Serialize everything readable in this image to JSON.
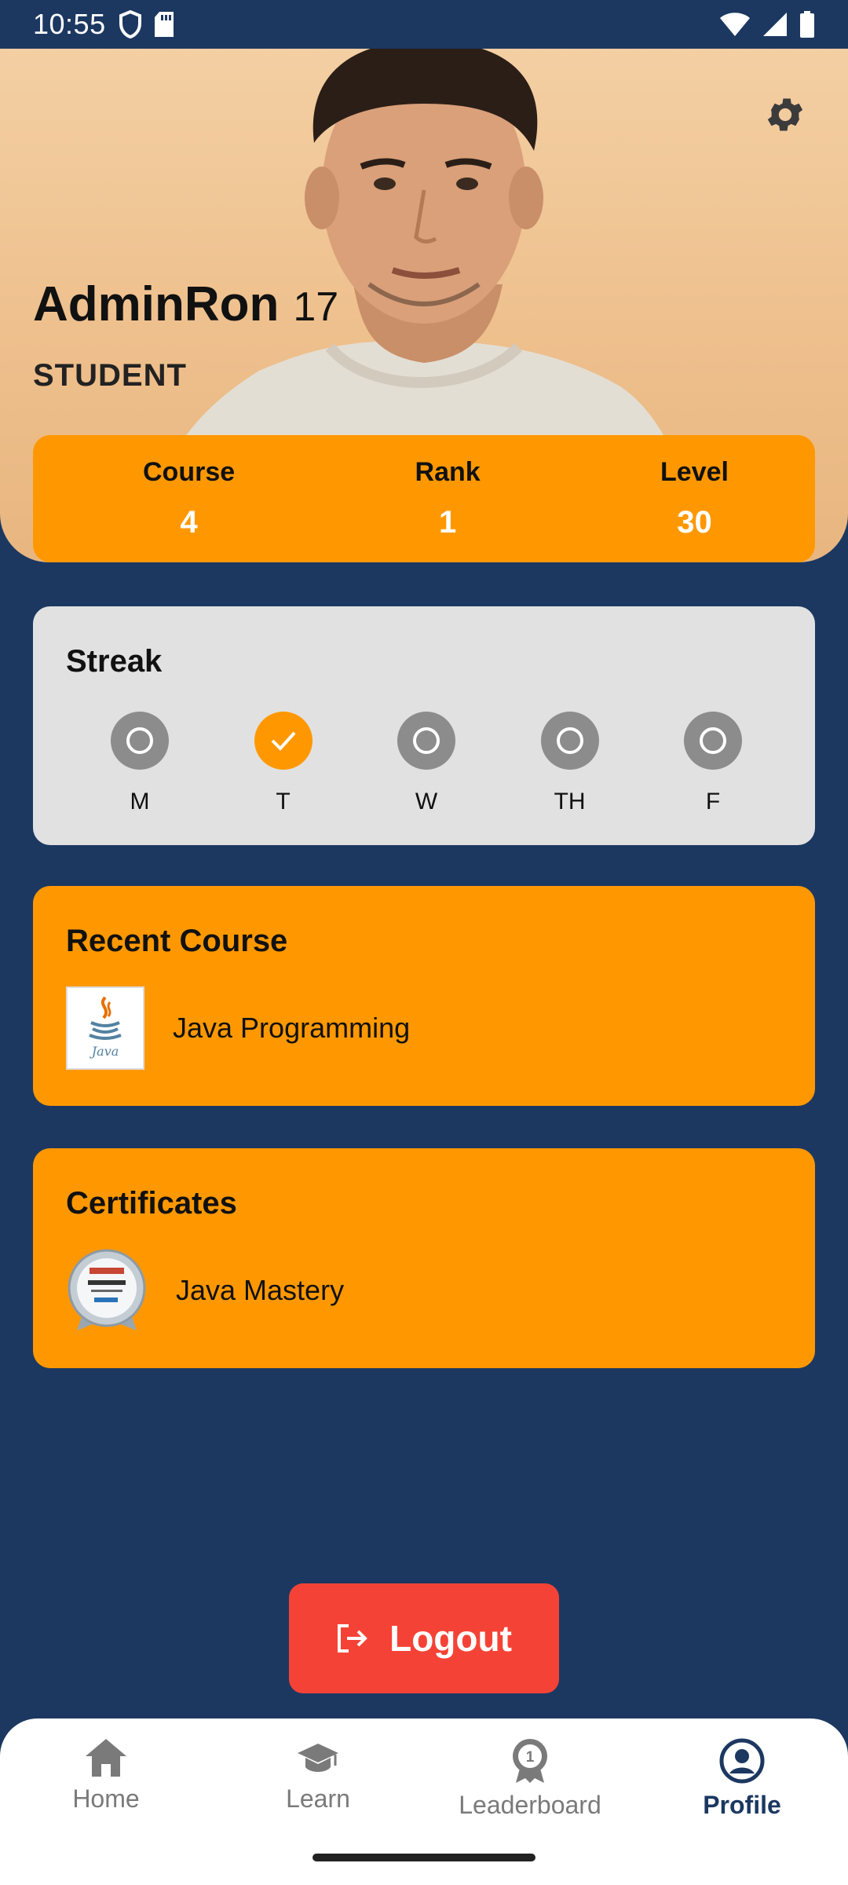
{
  "status_bar": {
    "time": "10:55",
    "icons": [
      "shield-icon",
      "sd-card-icon",
      "wifi-icon",
      "signal-icon",
      "battery-icon"
    ]
  },
  "profile": {
    "name": "AdminRon",
    "age": "17",
    "role": "STUDENT"
  },
  "stats": [
    {
      "label": "Course",
      "value": "4"
    },
    {
      "label": "Rank",
      "value": "1"
    },
    {
      "label": "Level",
      "value": "30"
    }
  ],
  "streak": {
    "title": "Streak",
    "days": [
      {
        "label": "M",
        "done": false
      },
      {
        "label": "T",
        "done": true
      },
      {
        "label": "W",
        "done": false
      },
      {
        "label": "TH",
        "done": false
      },
      {
        "label": "F",
        "done": false
      }
    ]
  },
  "recent_course": {
    "title": "Recent Course",
    "item": "Java Programming",
    "icon": "java-logo-icon"
  },
  "certificates": {
    "title": "Certificates",
    "item": "Java Mastery",
    "icon": "certificate-badge-icon"
  },
  "logout": {
    "label": "Logout"
  },
  "nav": {
    "items": [
      {
        "label": "Home",
        "icon": "home-icon"
      },
      {
        "label": "Learn",
        "icon": "graduation-cap-icon"
      },
      {
        "label": "Leaderboard",
        "icon": "medal-icon"
      },
      {
        "label": "Profile",
        "icon": "profile-icon"
      }
    ],
    "active": "Profile"
  },
  "colors": {
    "background": "#1c3861",
    "accent": "#ff9800",
    "logout": "#f44336",
    "streak_card": "#e1e1e1"
  }
}
